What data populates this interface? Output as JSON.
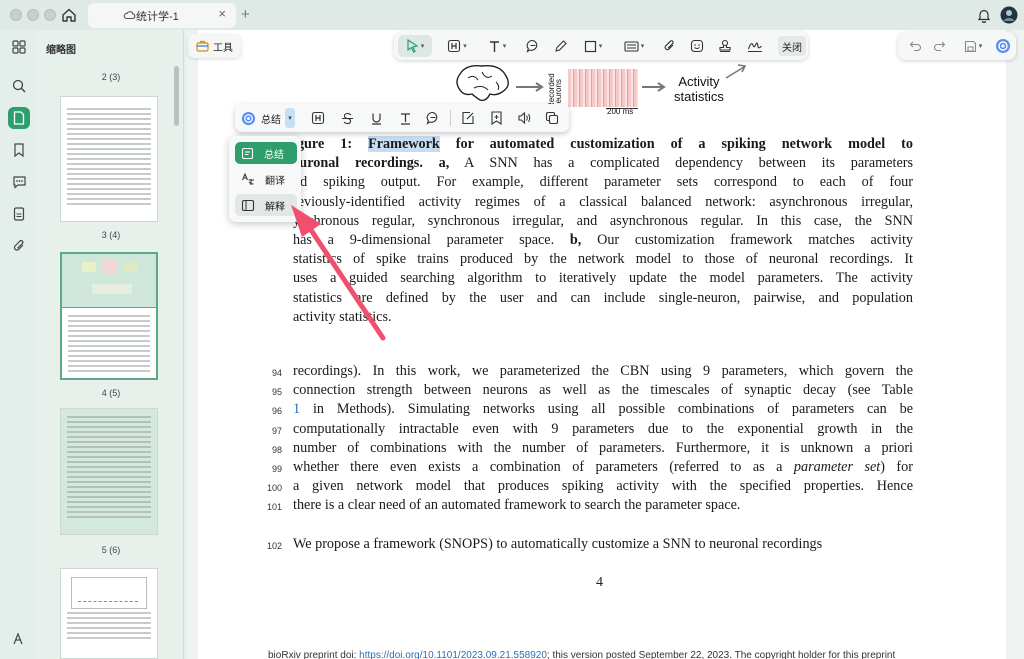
{
  "window": {
    "tab_title": "统计学-1",
    "tab_close": "×",
    "new_tab": "+"
  },
  "thumbnails": {
    "panel_title": "缩略图",
    "labels": [
      "2 (3)",
      "3 (4)",
      "4 (5)",
      "5 (6)"
    ]
  },
  "toolbar": {
    "tools_label": "工具",
    "close_label": "关闭"
  },
  "popup": {
    "summary_label": "总结",
    "menu": [
      "总结",
      "翻译",
      "解释"
    ]
  },
  "figure": {
    "side_label": "Recorded neurons",
    "time_label": "200 ms",
    "stats_line1": "Activity",
    "stats_line2": "statistics"
  },
  "caption": {
    "rows": [
      [
        "igure 1: ",
        "Framework",
        " for automated customization of a spiking network model to"
      ],
      [
        "euronal recordings. a,",
        " A SNN has a complicated dependency between its parameters"
      ],
      [
        "nd spiking output.  For example, different parameter sets correspond to each of four"
      ],
      [
        "reviously-identified activity regimes of a classical balanced network:  asynchronous irregular,"
      ],
      [
        "ynchronous regular, synchronous irregular, and asynchronous regular. In this case, the SNN"
      ],
      [
        "has a 9-dimensional parameter space.  ",
        "b,",
        " Our customization framework matches activity"
      ],
      [
        "statistics of spike trains produced by the network model to those of neuronal recordings. It"
      ],
      [
        "uses a guided searching algorithm to iteratively update the model parameters. The activity"
      ],
      [
        "statistics are defined by the user and can include single-neuron, pairwise, and population"
      ],
      [
        "activity statistics."
      ]
    ]
  },
  "body": {
    "line_numbers": [
      "94",
      "95",
      "96",
      "97",
      "98",
      "99",
      "100",
      "101"
    ],
    "rows": [
      [
        "recordings). In this work, we parameterized the CBN using 9 parameters, which govern the"
      ],
      [
        "connection strength between neurons as well as the timescales of synaptic decay (see Table"
      ],
      [
        "",
        "1",
        " in Methods). Simulating networks using all possible combinations of parameters can be"
      ],
      [
        "computationally intractable even with 9 parameters due to the exponential growth in the"
      ],
      [
        "number of combinations with the number of parameters. Furthermore, it is unknown a priori"
      ],
      [
        "whether there even exists a combination of parameters (referred to as a ",
        "parameter set",
        ") for"
      ],
      [
        "a given network model that produces spiking activity with the specified properties. Hence"
      ],
      [
        "there is a clear need of an automated framework to search the parameter space."
      ]
    ],
    "line_102_num": "102",
    "line_102": "We propose a framework (SNOPS) to automatically customize a SNN to neuronal recordings",
    "page_number": "4"
  },
  "footer": {
    "prefix": "bioRxiv preprint doi: ",
    "doi": "https://doi.org/10.1101/2023.09.21.558920",
    "suffix": "; this version posted September 22, 2023. The copyright holder for this preprint"
  },
  "colors": {
    "accent_green": "#2e9e6c",
    "highlight_blue": "#c7dcf2",
    "arrow_red": "#f0506e"
  }
}
